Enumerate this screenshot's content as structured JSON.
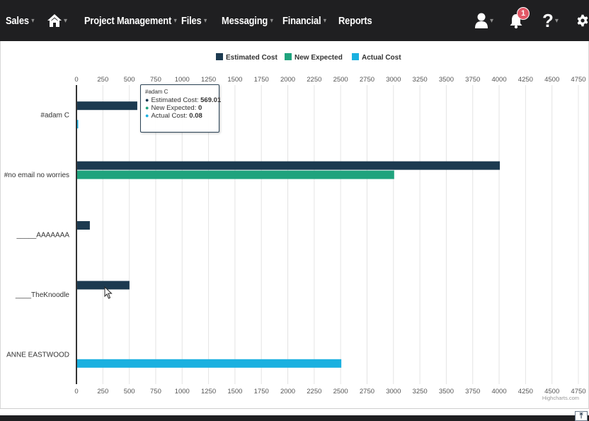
{
  "nav": {
    "sales": "Sales",
    "project_management": "Project Management",
    "files": "Files",
    "messaging": "Messaging",
    "financial": "Financial",
    "reports": "Reports",
    "notification_count": "1",
    "help": "?",
    "caret": "▾",
    "icons": {
      "home": "home-icon",
      "user": "user-icon",
      "bell": "bell-icon",
      "settings": "gear-icon"
    }
  },
  "tooltip": {
    "header": "#adam C",
    "rows": [
      {
        "label": "Estimated Cost: ",
        "value": "569.01",
        "color": "#1c3a50"
      },
      {
        "label": "New Expected: ",
        "value": "0",
        "color": "#1fa37d"
      },
      {
        "label": "Actual Cost: ",
        "value": "0.08",
        "color": "#1ab0e0"
      }
    ]
  },
  "chart_data": {
    "type": "bar",
    "orientation": "horizontal",
    "categories": [
      "#adam C",
      "#no email no worries",
      "_____AAAAAAA",
      "____TheKnoodle",
      "ANNE EASTWOOD"
    ],
    "series": [
      {
        "name": "Estimated Cost",
        "color": "#1c3a50",
        "values": [
          569.01,
          4000,
          120,
          495,
          0
        ]
      },
      {
        "name": "New Expected",
        "color": "#1fa37d",
        "values": [
          0,
          3000,
          0,
          0,
          0
        ]
      },
      {
        "name": "Actual Cost",
        "color": "#1ab0e0",
        "values": [
          0.08,
          0,
          0,
          0,
          2500
        ]
      }
    ],
    "xlim": [
      0,
      4750
    ],
    "xticks": [
      "0",
      "250",
      "500",
      "750",
      "1000",
      "1250",
      "1500",
      "1750",
      "2000",
      "2250",
      "2500",
      "2750",
      "3000",
      "3250",
      "3500",
      "3750",
      "4000",
      "4250",
      "4500",
      "4750"
    ],
    "grid": true,
    "legend_position": "top-center",
    "credits": "Highcharts.com"
  }
}
